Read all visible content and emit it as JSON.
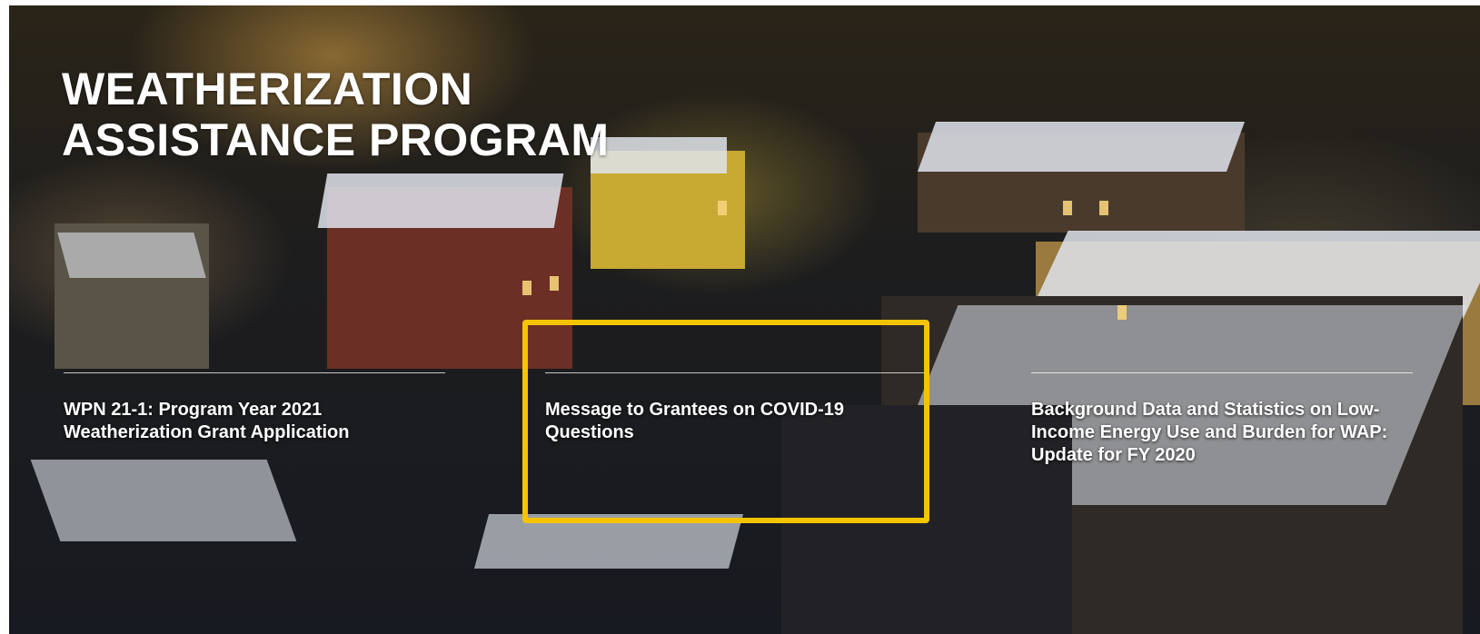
{
  "hero": {
    "title_line1": "WEATHERIZATION",
    "title_line2": "ASSISTANCE PROGRAM",
    "background_icon": "city-night-photo"
  },
  "cards": [
    {
      "text": "WPN 21-1: Program Year 2021 Weatherization Grant Application"
    },
    {
      "text": "Message to Grantees on COVID-19 Questions"
    },
    {
      "text": "Background Data and Statistics on Low-Income Energy Use and Burden for WAP: Update for FY 2020"
    }
  ],
  "highlight": {
    "color": "#f5c400"
  }
}
